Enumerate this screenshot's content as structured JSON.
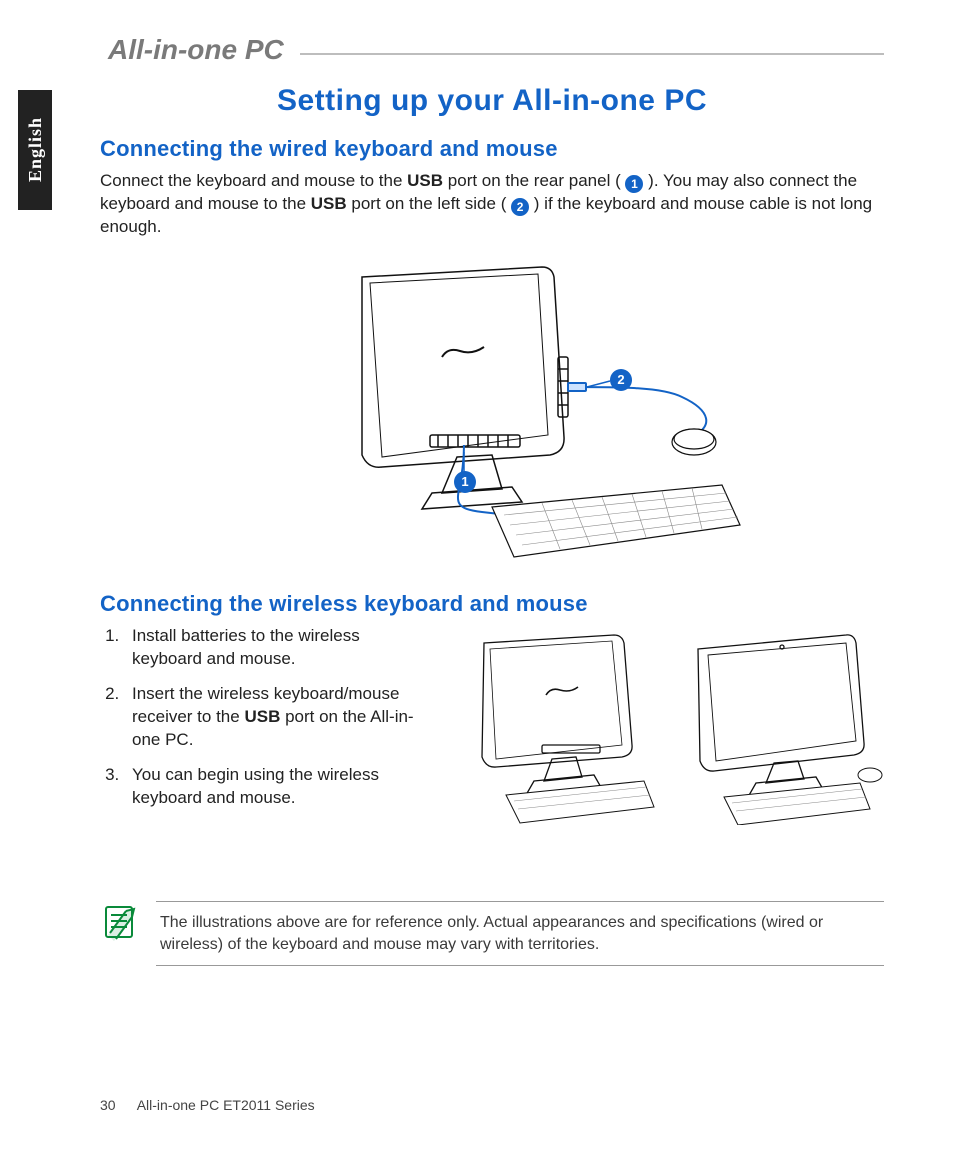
{
  "header": {
    "brand": "All-in-one PC"
  },
  "language_tab": "English",
  "title": "Setting up your All-in-one PC",
  "section1": {
    "heading": "Connecting the wired keyboard and mouse",
    "para_parts": {
      "a": "Connect the keyboard and mouse to the ",
      "usb1": "USB",
      "b": " port on the rear panel ( ",
      "c": " ). You may also connect the keyboard and mouse to the ",
      "usb2": "USB",
      "d": " port on the left side ( ",
      "e": " ) if the keyboard and mouse cable is not long enough."
    },
    "callouts": {
      "rear": "1",
      "side": "2"
    }
  },
  "section2": {
    "heading": "Connecting the wireless keyboard and mouse",
    "steps": [
      "Install batteries to the wireless keyboard and mouse.",
      {
        "pre": "Insert the wireless keyboard/mouse receiver to the ",
        "bold": "USB",
        "post": " port on the All-in-one PC."
      },
      "You can begin using the wireless keyboard and mouse."
    ]
  },
  "note": "The illustrations above are for reference only. Actual appearances and specifications (wired or wireless) of the keyboard and mouse may vary with territories.",
  "footer": {
    "page_number": "30",
    "doc_title": "All-in-one PC ET2011 Series"
  }
}
